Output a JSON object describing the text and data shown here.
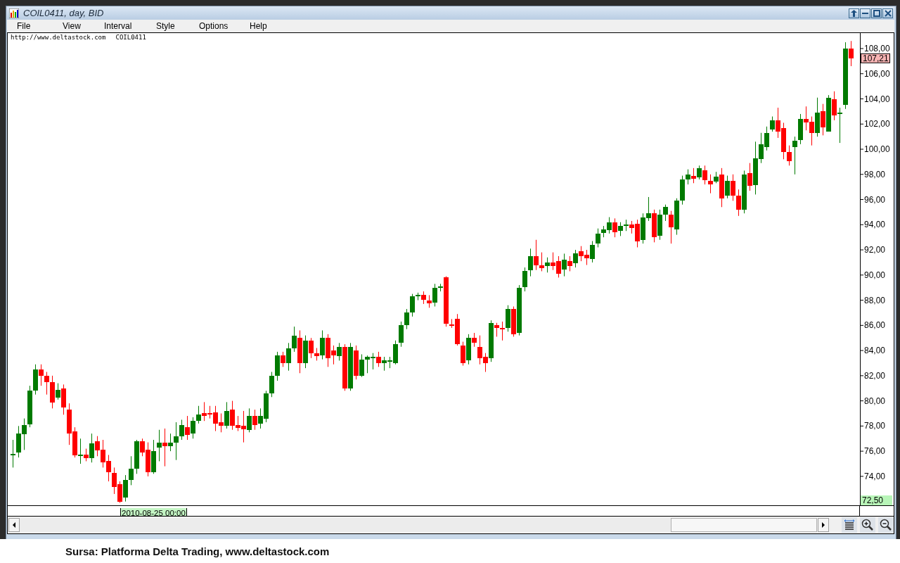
{
  "window": {
    "title": "COIL0411, day, BID"
  },
  "menu": [
    "File",
    "View",
    "Interval",
    "Style",
    "Options",
    "Help"
  ],
  "chart": {
    "source_url": "http://www.deltastock.com",
    "symbol": "COIL0411",
    "current_price": "107,21",
    "low_price": "72,50",
    "cursor_date": "2010-08-25 00:00",
    "chart_data": {
      "type": "candlestick",
      "ylim": [
        71.7,
        109.23
      ],
      "yticks": [
        {
          "value": 74,
          "label": "74,00"
        },
        {
          "value": 76,
          "label": "76,00"
        },
        {
          "value": 78,
          "label": "78,00"
        },
        {
          "value": 80,
          "label": "80,00"
        },
        {
          "value": 82,
          "label": "82,00"
        },
        {
          "value": 84,
          "label": "84,00"
        },
        {
          "value": 86,
          "label": "86,00"
        },
        {
          "value": 88,
          "label": "88,00"
        },
        {
          "value": 90,
          "label": "90,00"
        },
        {
          "value": 92,
          "label": "92,00"
        },
        {
          "value": 94,
          "label": "94,00"
        },
        {
          "value": 96,
          "label": "96,00"
        },
        {
          "value": 98,
          "label": "98,00"
        },
        {
          "value": 100,
          "label": "100,00"
        },
        {
          "value": 102,
          "label": "102,00"
        },
        {
          "value": 104,
          "label": "104,00"
        },
        {
          "value": 106,
          "label": "106,00"
        },
        {
          "value": 108,
          "label": "108,00"
        }
      ],
      "categories": [
        null,
        null,
        null,
        null,
        null,
        null,
        null,
        null,
        null,
        null,
        null,
        null,
        null,
        null,
        null,
        null,
        null,
        null,
        null,
        null,
        null,
        null,
        null,
        null,
        null,
        null,
        null,
        null,
        null,
        null,
        null,
        null,
        null,
        null,
        null,
        null,
        null,
        null,
        null,
        null,
        null,
        null,
        null,
        null,
        null,
        null,
        null,
        null,
        null,
        null,
        null,
        null,
        null,
        null,
        null,
        null,
        null,
        null,
        null,
        null,
        null,
        null,
        null,
        null,
        null,
        null,
        null,
        null,
        null,
        null,
        null,
        null,
        null,
        null,
        null,
        null,
        null,
        null,
        null,
        null,
        null,
        null,
        null,
        null,
        null,
        null,
        null,
        null,
        null,
        null,
        null,
        null,
        null,
        null,
        null,
        null,
        null,
        null,
        null,
        null,
        null,
        null,
        null,
        null,
        null,
        null,
        null,
        null,
        null,
        null,
        null,
        null,
        null,
        null,
        null,
        null,
        null,
        null,
        null,
        null,
        null,
        null,
        null,
        null,
        null,
        null,
        null,
        null,
        null,
        null,
        null,
        null,
        null,
        null,
        null,
        null,
        null,
        null,
        null,
        null,
        null,
        null,
        null,
        null,
        null,
        null,
        null,
        null,
        null,
        null
      ],
      "ohlc": [
        [
          75.8,
          76.9,
          74.7,
          75.8
        ],
        [
          75.9,
          78.0,
          75.5,
          77.4
        ],
        [
          77.4,
          78.6,
          76.1,
          78.1
        ],
        [
          78.1,
          81.2,
          77.9,
          80.8
        ],
        [
          80.8,
          82.9,
          80.5,
          82.5
        ],
        [
          82.5,
          82.9,
          81.2,
          82.0
        ],
        [
          82.0,
          82.3,
          80.5,
          81.5
        ],
        [
          81.5,
          82.0,
          79.4,
          79.9
        ],
        [
          80.3,
          81.4,
          80.1,
          80.9
        ],
        [
          81.0,
          81.3,
          78.9,
          79.5
        ],
        [
          79.3,
          79.8,
          76.5,
          77.4
        ],
        [
          77.6,
          77.9,
          75.5,
          75.7
        ],
        [
          75.7,
          77.0,
          75.0,
          75.7
        ],
        [
          75.7,
          76.2,
          75.2,
          75.4
        ],
        [
          75.4,
          77.4,
          75.1,
          76.6
        ],
        [
          76.8,
          77.2,
          75.6,
          76.1
        ],
        [
          76.1,
          76.9,
          74.7,
          75.1
        ],
        [
          75.2,
          75.7,
          73.6,
          74.3
        ],
        [
          74.3,
          74.7,
          72.6,
          73.2
        ],
        [
          73.4,
          73.6,
          71.9,
          72.0
        ],
        [
          72.3,
          74.1,
          72.0,
          73.7
        ],
        [
          73.7,
          75.6,
          73.3,
          74.6
        ],
        [
          74.6,
          76.9,
          74.2,
          76.8
        ],
        [
          76.8,
          77.0,
          75.6,
          75.9
        ],
        [
          76.1,
          76.7,
          74.0,
          74.3
        ],
        [
          74.3,
          76.9,
          74.2,
          76.0
        ],
        [
          76.3,
          77.7,
          75.2,
          76.7
        ],
        [
          76.7,
          77.8,
          74.8,
          76.4
        ],
        [
          76.4,
          77.4,
          76.0,
          76.7
        ],
        [
          76.7,
          78.3,
          75.3,
          77.2
        ],
        [
          77.2,
          78.5,
          76.9,
          78.1
        ],
        [
          77.9,
          78.8,
          76.9,
          77.3
        ],
        [
          77.4,
          78.7,
          77.0,
          78.4
        ],
        [
          78.4,
          79.6,
          78.2,
          78.9
        ],
        [
          79.0,
          79.9,
          78.4,
          78.8
        ],
        [
          79.0,
          79.6,
          78.6,
          78.9
        ],
        [
          79.1,
          79.6,
          77.6,
          78.2
        ],
        [
          78.3,
          79.0,
          77.5,
          78.0
        ],
        [
          78.0,
          79.9,
          77.8,
          79.2
        ],
        [
          79.3,
          80.0,
          77.7,
          78.0
        ],
        [
          78.1,
          78.8,
          77.6,
          77.9
        ],
        [
          78.0,
          79.2,
          76.7,
          77.7
        ],
        [
          77.7,
          79.4,
          77.5,
          78.8
        ],
        [
          78.8,
          79.3,
          77.7,
          78.1
        ],
        [
          78.2,
          79.4,
          77.8,
          78.8
        ],
        [
          78.6,
          80.8,
          78.3,
          80.6
        ],
        [
          80.6,
          82.3,
          80.3,
          82.0
        ],
        [
          82.0,
          83.9,
          81.6,
          83.6
        ],
        [
          83.6,
          83.9,
          82.7,
          83.0
        ],
        [
          83.0,
          84.6,
          82.4,
          84.2
        ],
        [
          84.2,
          85.9,
          83.9,
          85.2
        ],
        [
          85.0,
          85.6,
          82.2,
          83.0
        ],
        [
          83.0,
          85.2,
          82.6,
          84.8
        ],
        [
          84.8,
          85.0,
          83.4,
          83.8
        ],
        [
          83.8,
          84.2,
          83.2,
          83.6
        ],
        [
          83.6,
          85.6,
          83.3,
          85.0
        ],
        [
          85.0,
          85.3,
          82.7,
          83.4
        ],
        [
          84.0,
          84.4,
          82.9,
          83.6
        ],
        [
          83.6,
          84.6,
          83.2,
          84.3
        ],
        [
          84.3,
          84.5,
          80.8,
          81.0
        ],
        [
          81.0,
          84.6,
          80.8,
          84.3
        ],
        [
          84.0,
          84.4,
          81.7,
          82.0
        ],
        [
          82.0,
          83.7,
          81.9,
          83.3
        ],
        [
          83.3,
          83.6,
          82.2,
          83.5
        ],
        [
          83.5,
          83.8,
          82.5,
          83.5
        ],
        [
          83.5,
          83.9,
          82.7,
          83.0
        ],
        [
          83.0,
          83.5,
          82.4,
          83.2
        ],
        [
          83.2,
          83.5,
          82.6,
          83.2
        ],
        [
          83.0,
          84.8,
          82.9,
          84.5
        ],
        [
          84.6,
          86.3,
          84.3,
          86.0
        ],
        [
          86.0,
          87.3,
          85.7,
          87.0
        ],
        [
          87.0,
          88.5,
          86.7,
          88.3
        ],
        [
          88.3,
          88.6,
          88.0,
          88.4
        ],
        [
          88.4,
          88.7,
          87.7,
          88.0
        ],
        [
          88.0,
          88.4,
          87.4,
          87.8
        ],
        [
          87.8,
          89.3,
          87.5,
          89.0
        ],
        [
          89.0,
          89.3,
          88.7,
          89.1
        ],
        [
          89.8,
          89.9,
          85.9,
          86.1
        ],
        [
          86.1,
          86.5,
          85.8,
          86.0
        ],
        [
          86.5,
          86.9,
          84.4,
          84.5
        ],
        [
          84.4,
          84.7,
          82.8,
          83.0
        ],
        [
          83.2,
          85.3,
          82.9,
          85.0
        ],
        [
          85.0,
          85.4,
          84.3,
          84.6
        ],
        [
          84.3,
          85.2,
          82.9,
          83.4
        ],
        [
          83.5,
          83.8,
          82.3,
          83.0
        ],
        [
          83.4,
          86.4,
          83.1,
          86.2
        ],
        [
          86.0,
          86.2,
          85.1,
          85.8
        ],
        [
          85.8,
          86.3,
          84.8,
          85.7
        ],
        [
          85.8,
          87.6,
          85.5,
          87.3
        ],
        [
          87.3,
          87.5,
          85.1,
          85.3
        ],
        [
          85.4,
          89.2,
          85.2,
          89.0
        ],
        [
          89.0,
          90.6,
          88.7,
          90.3
        ],
        [
          90.4,
          92.1,
          89.9,
          91.5
        ],
        [
          91.5,
          92.8,
          90.4,
          90.8
        ],
        [
          90.8,
          91.8,
          90.3,
          90.6
        ],
        [
          90.7,
          91.4,
          90.2,
          91.0
        ],
        [
          91.0,
          91.8,
          90.4,
          90.7
        ],
        [
          91.1,
          91.5,
          89.8,
          90.1
        ],
        [
          90.4,
          91.7,
          89.9,
          91.2
        ],
        [
          91.1,
          91.5,
          90.3,
          90.7
        ],
        [
          90.9,
          92.0,
          90.6,
          91.7
        ],
        [
          91.9,
          92.3,
          91.1,
          91.5
        ],
        [
          91.6,
          92.0,
          90.8,
          91.3
        ],
        [
          91.3,
          92.7,
          91.0,
          92.4
        ],
        [
          92.5,
          93.7,
          92.2,
          93.3
        ],
        [
          93.3,
          93.9,
          93.0,
          93.6
        ],
        [
          93.6,
          94.6,
          93.3,
          94.2
        ],
        [
          94.2,
          94.5,
          93.0,
          93.4
        ],
        [
          93.5,
          94.2,
          93.1,
          93.9
        ],
        [
          93.9,
          94.4,
          93.5,
          94.0
        ],
        [
          94.0,
          94.3,
          93.3,
          93.7
        ],
        [
          94.1,
          94.4,
          92.2,
          92.7
        ],
        [
          92.8,
          94.9,
          92.5,
          94.6
        ],
        [
          94.5,
          96.2,
          94.3,
          94.9
        ],
        [
          94.9,
          95.2,
          92.6,
          93.0
        ],
        [
          93.1,
          95.2,
          92.8,
          94.8
        ],
        [
          94.8,
          95.6,
          94.3,
          95.4
        ],
        [
          94.8,
          95.1,
          92.5,
          93.8
        ],
        [
          93.6,
          96.1,
          93.2,
          95.9
        ],
        [
          95.9,
          97.9,
          95.6,
          97.6
        ],
        [
          97.6,
          98.4,
          97.2,
          98.0
        ],
        [
          97.9,
          98.5,
          97.3,
          97.7
        ],
        [
          97.8,
          98.7,
          97.6,
          98.5
        ],
        [
          98.3,
          98.7,
          97.2,
          97.5
        ],
        [
          97.5,
          98.0,
          96.5,
          97.2
        ],
        [
          97.4,
          98.2,
          97.3,
          97.8
        ],
        [
          98.0,
          98.5,
          95.4,
          96.1
        ],
        [
          96.3,
          97.9,
          96.1,
          97.5
        ],
        [
          97.5,
          98.0,
          95.9,
          96.3
        ],
        [
          96.3,
          96.8,
          94.7,
          95.2
        ],
        [
          95.2,
          98.3,
          94.9,
          98.0
        ],
        [
          98.1,
          98.9,
          96.7,
          97.1
        ],
        [
          97.2,
          100.6,
          96.4,
          99.3
        ],
        [
          99.2,
          101.3,
          98.9,
          100.4
        ],
        [
          100.2,
          101.8,
          99.9,
          101.3
        ],
        [
          101.6,
          102.6,
          101.4,
          102.3
        ],
        [
          102.3,
          103.3,
          100.9,
          101.4
        ],
        [
          101.7,
          102.1,
          99.2,
          99.8
        ],
        [
          99.8,
          100.3,
          98.7,
          99.1
        ],
        [
          100.2,
          101.0,
          98.0,
          100.7
        ],
        [
          100.7,
          102.8,
          100.4,
          102.4
        ],
        [
          102.4,
          103.4,
          101.5,
          102.1
        ],
        [
          102.2,
          102.6,
          100.3,
          101.3
        ],
        [
          101.3,
          104.1,
          101.0,
          102.9
        ],
        [
          103.0,
          103.6,
          101.1,
          101.7
        ],
        [
          101.4,
          104.3,
          101.4,
          104.1
        ],
        [
          104.0,
          104.6,
          102.3,
          102.7
        ],
        [
          102.8,
          103.3,
          100.5,
          102.9
        ],
        [
          103.5,
          108.5,
          103.2,
          108.0
        ],
        [
          108.0,
          108.6,
          106.6,
          107.2
        ]
      ]
    }
  },
  "caption": "Sursa: Platforma Delta Trading, www.deltastock.com"
}
